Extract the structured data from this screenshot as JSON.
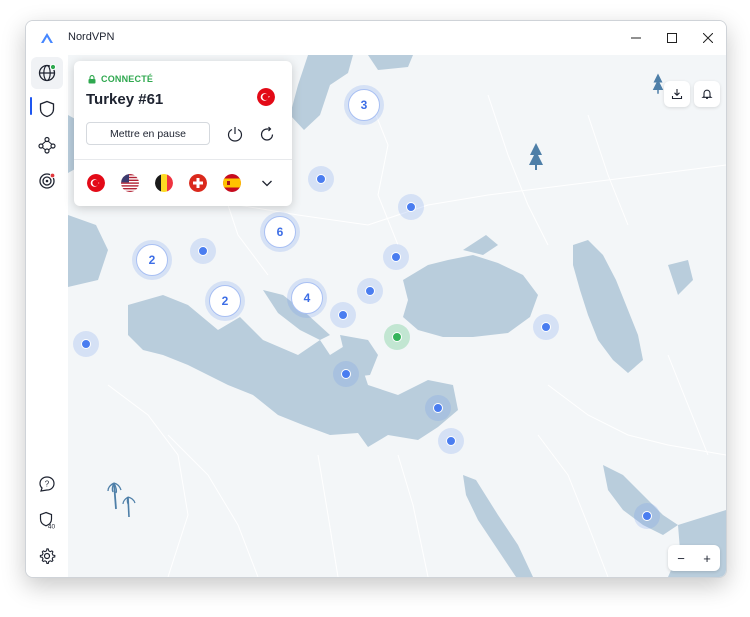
{
  "app": {
    "title": "NordVPN"
  },
  "connection": {
    "status": "CONNECTÉ",
    "server": "Turkey #61",
    "pause_label": "Mettre en pause"
  },
  "quick_connect_countries": [
    "Turkey",
    "United States",
    "Belgium",
    "Switzerland",
    "Spain"
  ],
  "map": {
    "clusters": [
      "3",
      "6",
      "2",
      "2",
      "4"
    ],
    "zoom_out": "−",
    "zoom_in": "+"
  },
  "sidebar": {
    "items": [
      "globe-icon",
      "shield-icon",
      "meshnet-icon",
      "target-icon"
    ],
    "bottom": [
      "help-icon",
      "shield-40-icon",
      "settings-icon"
    ],
    "badge": "40"
  },
  "colors": {
    "accent": "#4a7df0",
    "connected": "#2fa84f",
    "water": "#b9cddc",
    "land": "#f3f6f8"
  }
}
